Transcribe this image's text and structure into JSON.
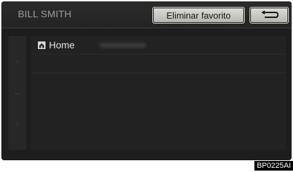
{
  "header": {
    "title": "BILL SMITH",
    "delete_favorite_label": "Eliminar favorito"
  },
  "list": {
    "items": [
      {
        "label": "Home",
        "icon": "home-icon"
      }
    ]
  },
  "image_code": "BP0225AI",
  "colors": {
    "screen_bg": "#1c1d1c",
    "button_bg": "#c8c9c4",
    "text_light": "#e4e4e2",
    "title_text": "#9d9e9c"
  }
}
